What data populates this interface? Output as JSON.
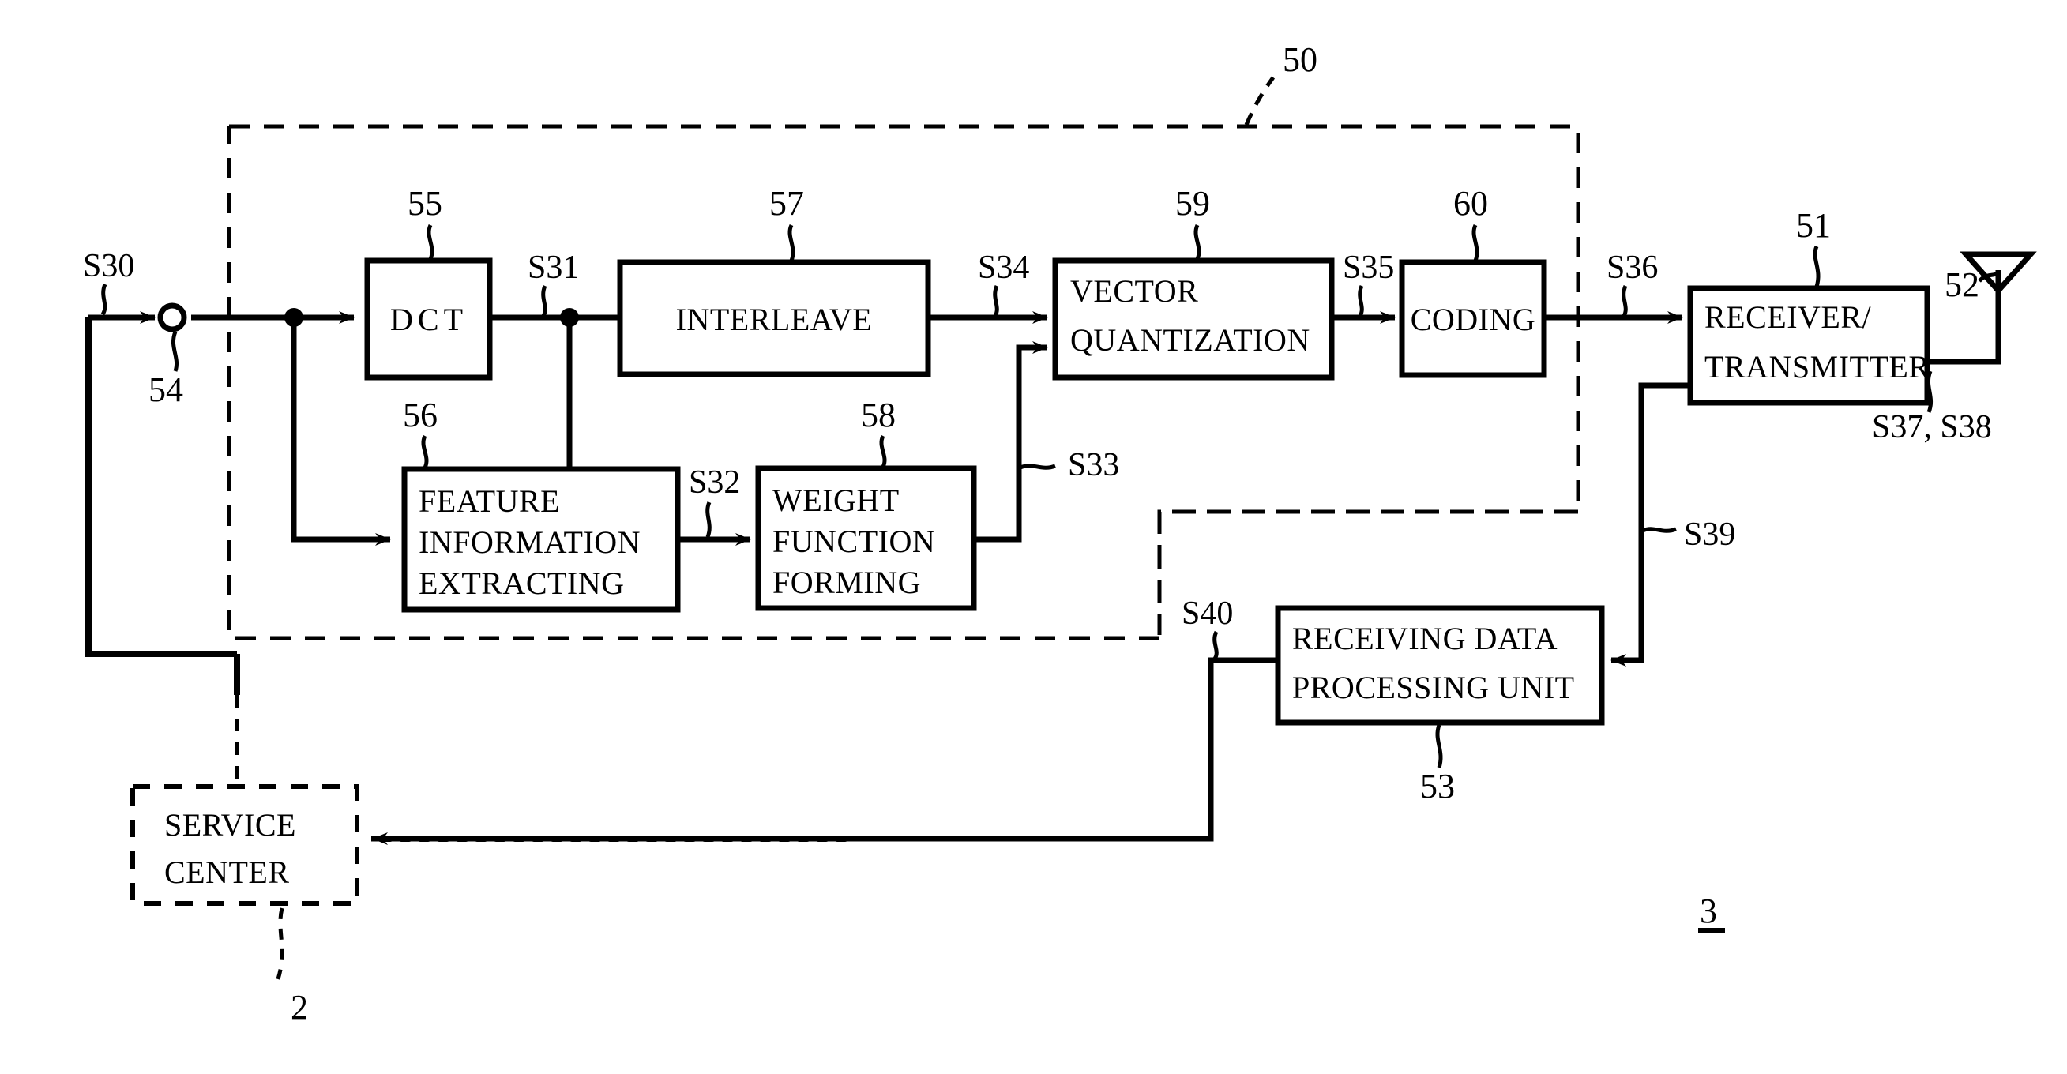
{
  "figure": {
    "figure_label": "3",
    "enclosure_ref": "50",
    "service_center_ref": "2"
  },
  "blocks": [
    {
      "id": "dct",
      "ref": "55",
      "lines": [
        "DCT"
      ]
    },
    {
      "id": "interleave",
      "ref": "57",
      "lines": [
        "INTERLEAVE"
      ]
    },
    {
      "id": "vq",
      "ref": "59",
      "lines": [
        "VECTOR",
        "QUANTIZATION"
      ]
    },
    {
      "id": "coding",
      "ref": "60",
      "lines": [
        "CODING"
      ]
    },
    {
      "id": "feature",
      "ref": "56",
      "lines": [
        "FEATURE",
        "INFORMATION",
        "EXTRACTING"
      ]
    },
    {
      "id": "weight",
      "ref": "58",
      "lines": [
        "WEIGHT",
        "FUNCTION",
        "FORMING"
      ]
    },
    {
      "id": "rxtx",
      "ref": "51",
      "lines": [
        "RECEIVER/",
        "TRANSMITTER"
      ]
    },
    {
      "id": "rdpu",
      "ref": "53",
      "lines": [
        "RECEIVING DATA",
        "PROCESSING UNIT"
      ]
    },
    {
      "id": "service",
      "ref": "2",
      "lines": [
        "SERVICE",
        "CENTER"
      ]
    }
  ],
  "refs": {
    "dct": "55",
    "feature": "56",
    "interleave": "57",
    "weight": "58",
    "vq": "59",
    "coding": "60",
    "rxtx": "51",
    "antenna": "52",
    "rdpu": "53",
    "node": "54",
    "enclosure": "50",
    "service_center": "2",
    "figure": "3"
  },
  "signals": {
    "s30": "S30",
    "s31": "S31",
    "s32": "S32",
    "s33": "S33",
    "s34": "S34",
    "s35": "S35",
    "s36": "S36",
    "s37_s38": "S37, S38",
    "s39": "S39",
    "s40": "S40"
  },
  "icons": {
    "antenna": "antenna-icon",
    "junction_open": "open-junction-node",
    "junction_solid": "solid-junction-node"
  },
  "colors": {
    "stroke": "#000000",
    "background": "#ffffff"
  }
}
